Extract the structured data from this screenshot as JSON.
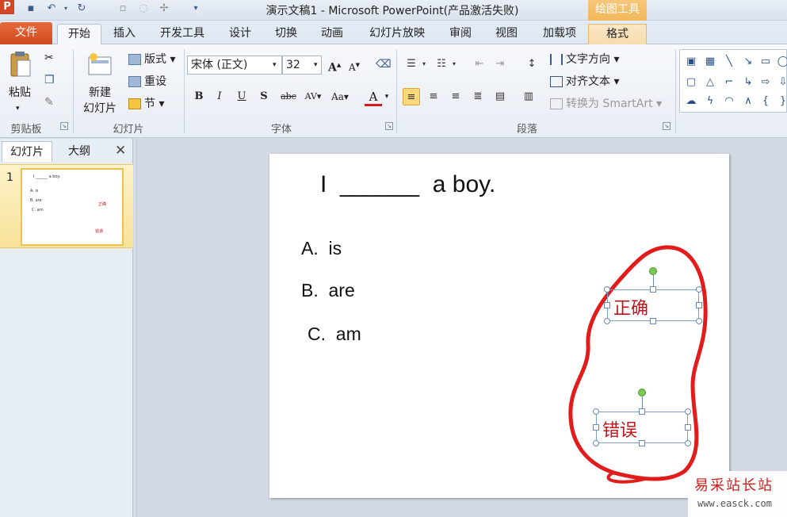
{
  "window": {
    "title": "演示文稿1 - Microsoft PowerPoint(产品激活失败)",
    "app_icon": "P",
    "contextual_header": "绘图工具"
  },
  "tabs": {
    "file": "文件",
    "items": [
      "开始",
      "插入",
      "开发工具",
      "设计",
      "切换",
      "动画",
      "幻灯片放映",
      "审阅",
      "视图",
      "加载项",
      "格式"
    ]
  },
  "ribbon": {
    "clipboard": {
      "paste": "粘贴",
      "group": "剪贴板"
    },
    "slides": {
      "new_slide_1": "新建",
      "new_slide_2": "幻灯片",
      "layout": "版式",
      "reset": "重设",
      "section": "节",
      "group": "幻灯片"
    },
    "font": {
      "name": "宋体 (正文)",
      "size": "32",
      "group": "字体"
    },
    "paragraph": {
      "text_direction": "文字方向",
      "align_text": "对齐文本",
      "convert_smartart": "转换为 SmartArt",
      "group": "段落"
    }
  },
  "left_panel": {
    "tab_slides": "幻灯片",
    "tab_outline": "大纲",
    "thumb_number": "1",
    "thumb": {
      "title": "I ______ a boy.",
      "a": "A. is",
      "b": "B. are",
      "c": "C. am",
      "correct": "正确",
      "wrong": "错误"
    }
  },
  "slide": {
    "title": "I  ______  a boy.",
    "option_a": "A.  is",
    "option_b": "B.  are",
    "option_c": "C.  am",
    "textbox_correct": "正确",
    "textbox_wrong": "错误"
  },
  "watermark": {
    "title": "易采站长站",
    "url": "www.easck.com"
  },
  "colors": {
    "accent_red": "#c0141b",
    "file_tab": "#d24726",
    "context_tab": "#f1b75a"
  }
}
